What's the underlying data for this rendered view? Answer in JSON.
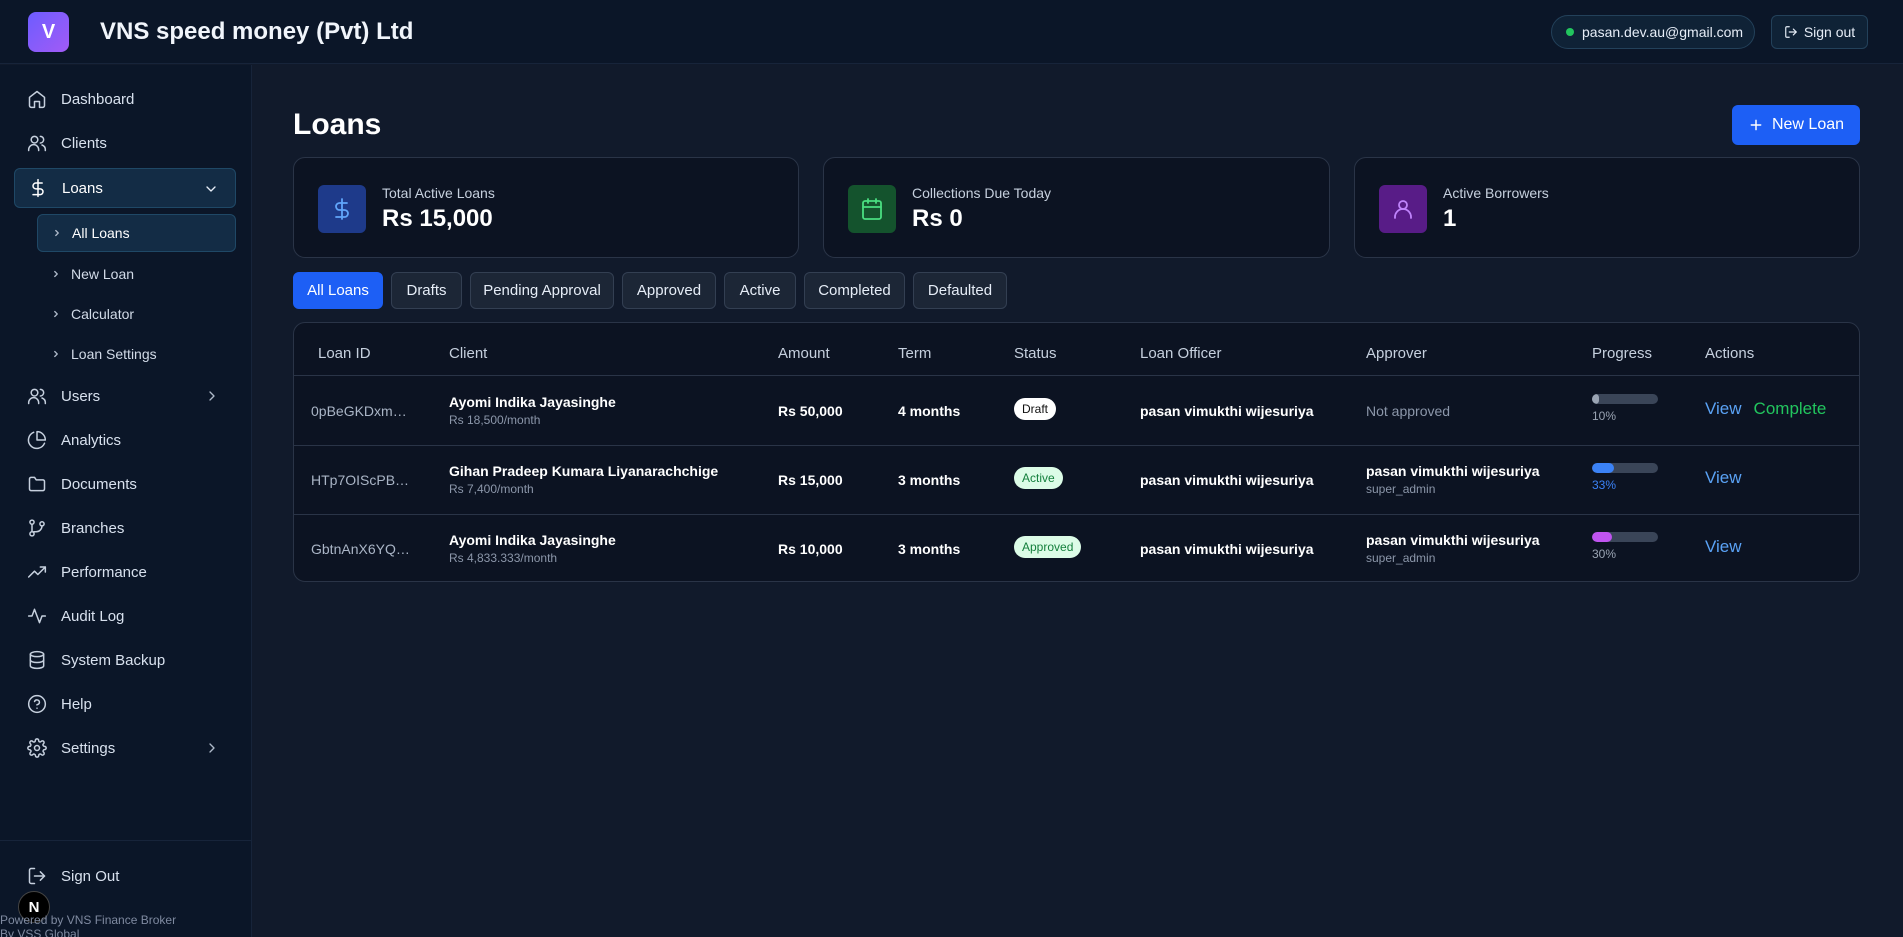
{
  "header": {
    "logo_letter": "V",
    "title": "VNS speed money (Pvt) Ltd",
    "user_email": "pasan.dev.au@gmail.com",
    "signout_label": "Sign out"
  },
  "sidebar": {
    "items": [
      {
        "label": "Dashboard",
        "icon": "home-icon"
      },
      {
        "label": "Clients",
        "icon": "users-icon"
      },
      {
        "label": "Loans",
        "icon": "dollar-icon"
      },
      {
        "label": "Users",
        "icon": "users-icon"
      },
      {
        "label": "Analytics",
        "icon": "pie-chart-icon"
      },
      {
        "label": "Documents",
        "icon": "folder-icon"
      },
      {
        "label": "Branches",
        "icon": "git-branch-icon"
      },
      {
        "label": "Performance",
        "icon": "trending-up-icon"
      },
      {
        "label": "Audit Log",
        "icon": "activity-icon"
      },
      {
        "label": "System Backup",
        "icon": "database-icon"
      },
      {
        "label": "Help",
        "icon": "help-circle-icon"
      },
      {
        "label": "Settings",
        "icon": "gear-icon"
      }
    ],
    "loans_sub": [
      "All Loans",
      "New Loan",
      "Calculator",
      "Loan Settings"
    ],
    "signout_label": "Sign Out",
    "badge_letter": "N",
    "powered_by_line1": "Powered by VNS Finance Broker",
    "powered_by_line2": "By VSS Global"
  },
  "main": {
    "title": "Loans",
    "new_loan_label": "New Loan",
    "stats": [
      {
        "label": "Total Active Loans",
        "value": "Rs 15,000",
        "icon": "dollar-icon",
        "color": "#60a5fa"
      },
      {
        "label": "Collections Due Today",
        "value": "Rs 0",
        "icon": "calendar-icon",
        "color": "#4ade80"
      },
      {
        "label": "Active Borrowers",
        "value": "1",
        "icon": "user-icon",
        "color": "#c084fc"
      }
    ],
    "filters": [
      "All Loans",
      "Drafts",
      "Pending Approval",
      "Approved",
      "Active",
      "Completed",
      "Defaulted"
    ],
    "table": {
      "columns": [
        "Loan ID",
        "Client",
        "Amount",
        "Term",
        "Status",
        "Loan Officer",
        "Approver",
        "Progress",
        "Actions"
      ],
      "rows": [
        {
          "loan_id": "0pBeGKDxm…",
          "client_name": "Ayomi Indika Jayasinghe",
          "client_sub": "Rs 18,500/month",
          "amount": "Rs 50,000",
          "term": "4 months",
          "status": "Draft",
          "officer": "pasan vimukthi wijesuriya",
          "approver_name": "Not approved",
          "approver_role": "",
          "progress": 10,
          "progress_label": "10%",
          "progress_color": "#9aa4b3",
          "actions": [
            "View",
            "Complete"
          ]
        },
        {
          "loan_id": "HTp7OIScPB…",
          "client_name": "Gihan Pradeep Kumara Liyanarachchige",
          "client_sub": "Rs 7,400/month",
          "amount": "Rs 15,000",
          "term": "3 months",
          "status": "Active",
          "officer": "pasan vimukthi wijesuriya",
          "approver_name": "pasan vimukthi wijesuriya",
          "approver_role": "super_admin",
          "progress": 33,
          "progress_label": "33%",
          "progress_color": "#3b82f6",
          "actions": [
            "View"
          ]
        },
        {
          "loan_id": "GbtnAnX6YQ…",
          "client_name": "Ayomi Indika Jayasinghe",
          "client_sub": "Rs 4,833.333/month",
          "amount": "Rs 10,000",
          "term": "3 months",
          "status": "Approved",
          "officer": "pasan vimukthi wijesuriya",
          "approver_name": "pasan vimukthi wijesuriya",
          "approver_role": "super_admin",
          "progress": 30,
          "progress_label": "30%",
          "progress_color": "#c054f0",
          "actions": [
            "View"
          ]
        }
      ]
    }
  }
}
